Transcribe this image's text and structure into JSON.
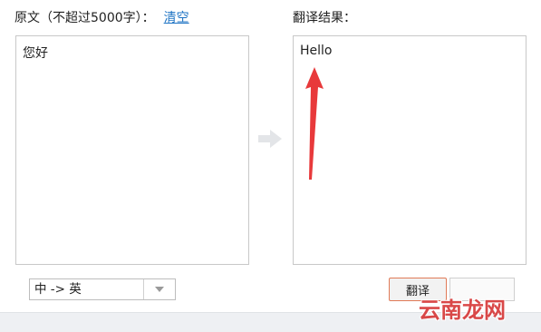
{
  "source": {
    "label": "原文（不超过5000字）：",
    "clear_link": "清空",
    "text": "您好"
  },
  "result": {
    "label": "翻译结果：",
    "text": "Hello"
  },
  "controls": {
    "language_pair": "中 -> 英",
    "translate_button": "翻译"
  },
  "watermark": "云南龙网",
  "colors": {
    "link": "#1f74c4",
    "annotation_arrow": "#e8393b",
    "translate_border": "#e07a57"
  }
}
